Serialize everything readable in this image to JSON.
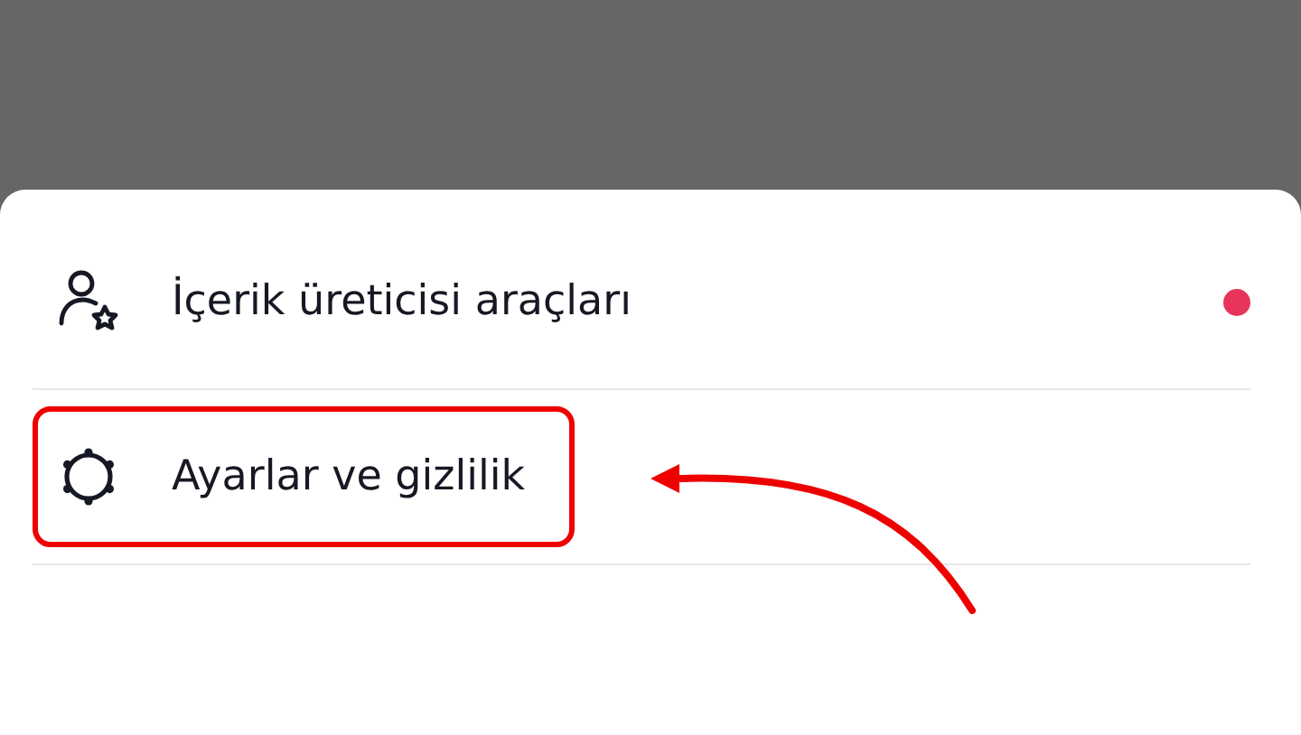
{
  "menu": {
    "items": [
      {
        "kind": "creator",
        "label": "İçerik üreticisi araçları",
        "color": "#e8345a",
        "highlighted": false
      },
      {
        "kind": "settings",
        "label": "Ayarlar ve gizlilik",
        "highlighted": true
      }
    ]
  },
  "annotation": {
    "kind": "arrow"
  }
}
